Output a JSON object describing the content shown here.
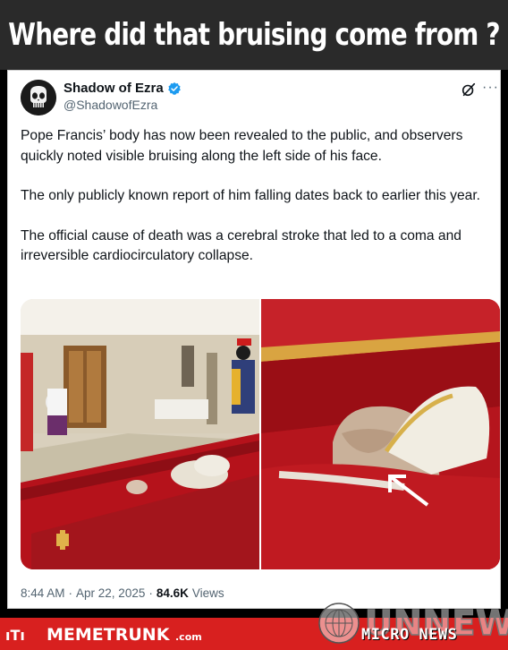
{
  "meme": {
    "title": "Where did that bruising come from ?"
  },
  "tweet": {
    "author": {
      "display_name": "Shadow of Ezra",
      "handle": "@ShadowofEzra",
      "verified": true
    },
    "paragraphs": [
      "Pope Francis’ body has now been revealed to the public, and observers quickly noted visible bruising along the left side of his face.",
      "The only publicly known report of him falling dates back to earlier this year.",
      "The official cause of death was a cerebral stroke that led to a coma and irreversible cardiocirculatory collapse."
    ],
    "footer": {
      "time": "8:44 AM",
      "date": "Apr 22, 2025",
      "separator": "·",
      "views_count": "84.6K",
      "views_label": "Views"
    },
    "more_label": "···"
  },
  "banner": {
    "brand_icon": "ıTı",
    "brand_name": "MEMETRUNK",
    "brand_suffix": ".com"
  },
  "watermark": {
    "logo": "UNNEWS",
    "tagline": "MICRO NEWS"
  },
  "colors": {
    "verified": "#1d9bf0",
    "banner": "#d8201f",
    "header_bg": "#2a2a2a"
  },
  "icons": [
    "punisher-skull-avatar-icon",
    "verified-badge-icon",
    "grok-icon",
    "more-options-icon",
    "annotation-arrow-icon"
  ]
}
